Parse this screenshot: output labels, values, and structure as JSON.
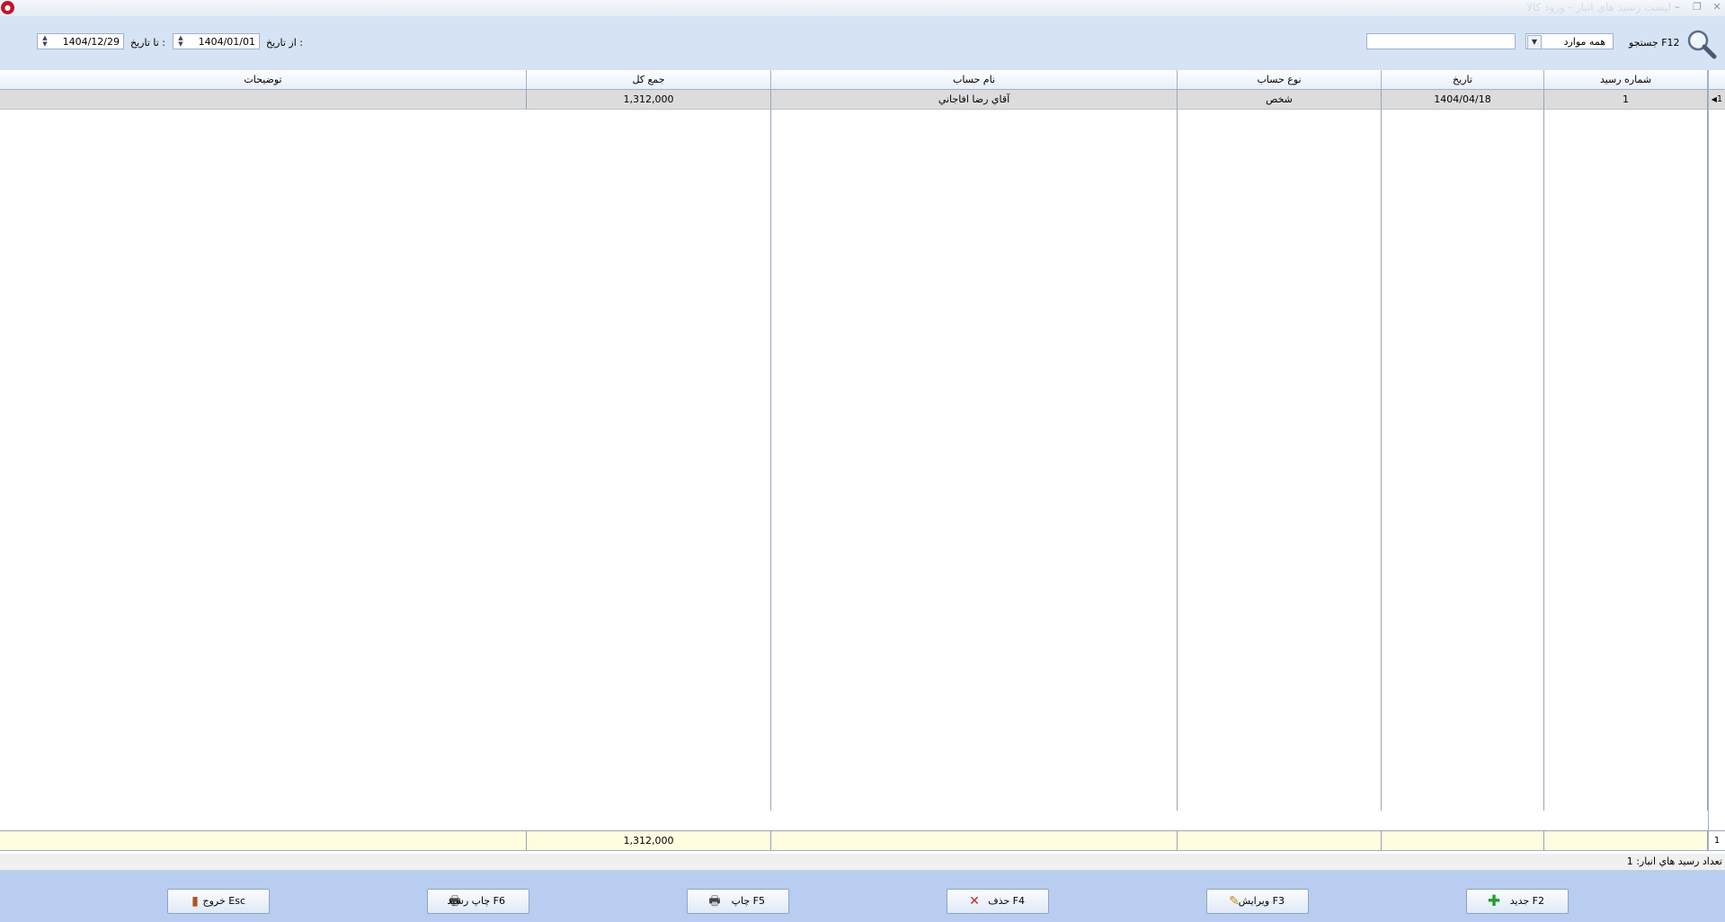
{
  "window": {
    "title": "ليست رسيد هاي انبار - ورود كالا",
    "app_icon": "app-logo-icon"
  },
  "toolbar": {
    "search_label": "جستجو F12",
    "search_value": "",
    "filter_selected": "همه موارد",
    "from_label": "از تاريخ :",
    "from_value": "1404/01/01",
    "to_label": "تا تاريخ :",
    "to_value": "1404/12/29"
  },
  "table": {
    "columns": [
      "شماره رسيد",
      "تاريخ",
      "نوع حساب",
      "نام حساب",
      "جمع كل",
      "توضيحات"
    ],
    "rows": [
      {
        "num": "1",
        "date": "1404/04/18",
        "type": "شخص",
        "name": "آقاي رضا افاجاني",
        "total": "1,312,000",
        "desc": "",
        "row_index": "1"
      }
    ],
    "footer": {
      "count": "1",
      "total": "1,312,000"
    }
  },
  "status": {
    "text": "تعداد رسيد هاي انبار: 1"
  },
  "buttons": {
    "new": "جديد F2",
    "edit": "ويرايش F3",
    "delete": "حذف F4",
    "print": "چاپ F5",
    "print_receipt": "چاپ رسيد F6",
    "exit": "خروج Esc"
  },
  "colors": {
    "toolbar_bg": "#d6e3f5",
    "button_bar_bg": "#b8cdef",
    "selected_row_bg": "#dcdcdc",
    "footer_bg": "#fffde0"
  }
}
